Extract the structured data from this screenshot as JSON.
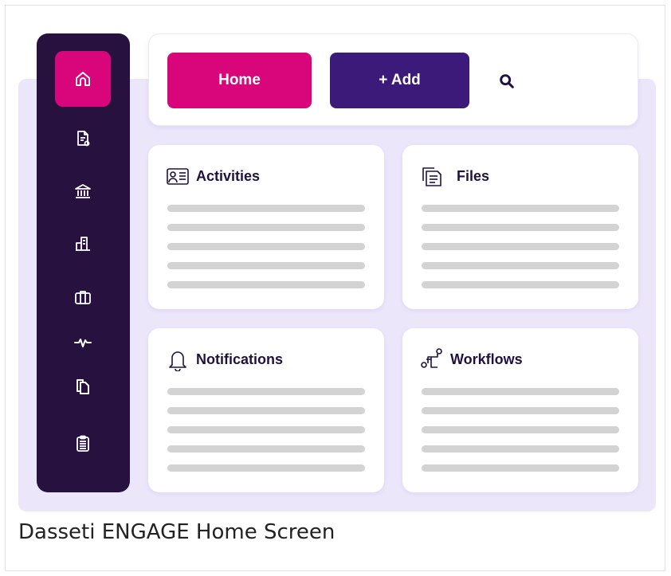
{
  "toolbar": {
    "home_label": "Home",
    "add_label": "+ Add"
  },
  "sidebar": {
    "items": [
      {
        "icon": "home-icon",
        "active": true
      },
      {
        "icon": "document-icon",
        "active": false
      },
      {
        "icon": "bank-icon",
        "active": false
      },
      {
        "icon": "buildings-icon",
        "active": false
      },
      {
        "icon": "briefcase-icon",
        "active": false
      },
      {
        "icon": "pulse-icon",
        "active": false
      },
      {
        "icon": "copy-icon",
        "active": false
      },
      {
        "icon": "clipboard-icon",
        "active": false
      }
    ]
  },
  "cards": [
    {
      "title": "Activities",
      "icon": "contact-card-icon"
    },
    {
      "title": "Files",
      "icon": "files-icon"
    },
    {
      "title": "Notifications",
      "icon": "bell-icon"
    },
    {
      "title": "Workflows",
      "icon": "workflow-icon"
    }
  ],
  "caption": "Dasseti ENGAGE Home Screen",
  "colors": {
    "sidebar": "#27123f",
    "accent_pink": "#d9067b",
    "accent_purple": "#3b1a7a",
    "panel": "#ece6fb"
  }
}
